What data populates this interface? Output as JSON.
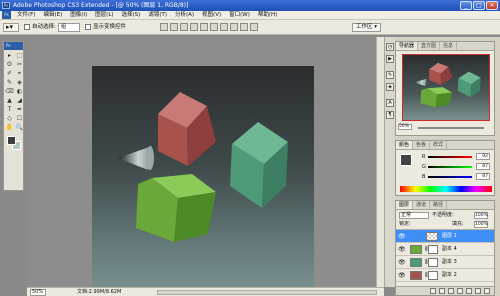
{
  "titlebar": {
    "app_icon": "Ps",
    "title": "Adobe Photoshop CS3 Extended - [@ 50% (图层 1, RGB/8)]",
    "controls": [
      "_",
      "□",
      "×"
    ]
  },
  "menubar": {
    "badge": "Ps",
    "items": [
      "文件(F)",
      "编辑(E)",
      "图像(I)",
      "图层(L)",
      "选择(S)",
      "滤镜(T)",
      "分析(A)",
      "视图(V)",
      "窗口(W)",
      "帮助(H)"
    ]
  },
  "options": {
    "auto_select_label": "自动选择:",
    "auto_select_value": "组",
    "show_transform_label": "显示变换控件",
    "workspace_label": "工作区 ▾"
  },
  "toolbox": {
    "header": "Ps",
    "tools": [
      "▸",
      "⬚",
      "ʘ",
      "✂",
      "✐",
      "⌖",
      "✎",
      "◈",
      "⌫",
      "◐",
      "▲",
      "◢",
      "T",
      "✒",
      "◇",
      "☐",
      "✋",
      "🔍"
    ]
  },
  "statusbar": {
    "zoom": "50%",
    "doc_info": "文档:2.99M/8.62M"
  },
  "navigator": {
    "tabs": [
      "导航器",
      "直方图",
      "信息"
    ],
    "zoom": "50%"
  },
  "color_panel": {
    "tabs": [
      "颜色",
      "色板",
      "样式"
    ],
    "channels": [
      {
        "label": "R",
        "value": "92"
      },
      {
        "label": "G",
        "value": "87"
      },
      {
        "label": "B",
        "value": "87"
      }
    ]
  },
  "layers_panel": {
    "tabs": [
      "图层",
      "通道",
      "路径"
    ],
    "blend_mode": "正常",
    "opacity_label": "不透明度:",
    "opacity_value": "100%",
    "lock_label": "锁定:",
    "fill_label": "填充:",
    "fill_value": "100%",
    "layers": [
      {
        "name": "图层 1",
        "selected": true
      },
      {
        "name": "副本 4",
        "selected": false
      },
      {
        "name": "副本 3",
        "selected": false
      },
      {
        "name": "副本 2",
        "selected": false
      }
    ]
  },
  "colors": {
    "selection": "#3d8ff5",
    "cube_red": "#b55a5a",
    "cube_green_teal": "#4f9a78",
    "cube_green": "#6aa83a"
  }
}
